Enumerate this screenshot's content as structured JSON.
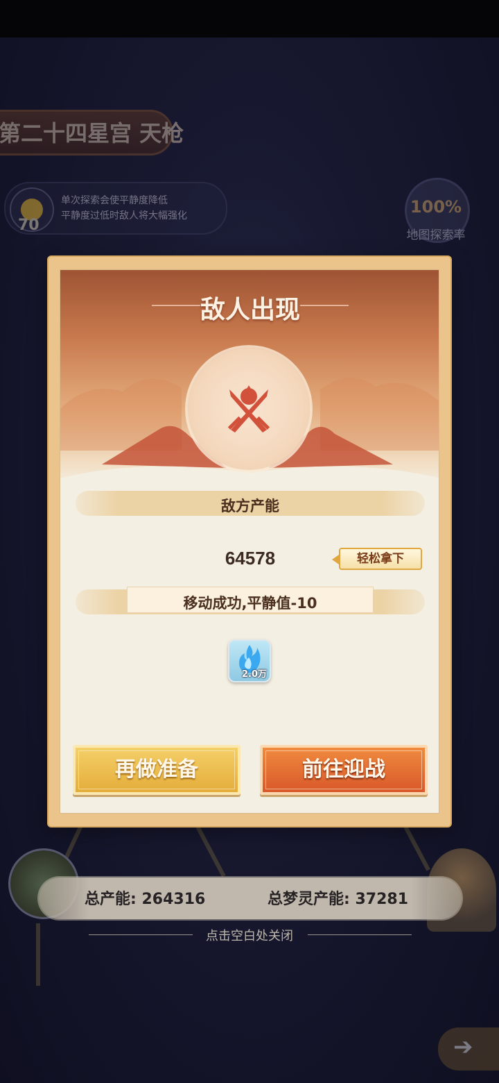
{
  "background": {
    "stage_name": "第二十四星宫 天枪",
    "calm": {
      "value": "70",
      "hint_line1": "单次探索会使平静度降低",
      "hint_line2": "平静度过低时敌人将大幅强化"
    },
    "exploration": {
      "rate": "100%",
      "label": "地图探索率"
    },
    "totals": {
      "total_power": "总产能: 264316",
      "dream_power": "总梦灵产能: 37281"
    },
    "close_hint": "点击空白处关闭"
  },
  "dialog": {
    "title": "敌人出现",
    "enemy_power_label": "敌方产能",
    "enemy_power_value": "64578",
    "difficulty_tag": "轻松拿下",
    "move_result": "移动成功,平静值-10",
    "reward": {
      "icon": "blue-flame-icon",
      "quantity": "2.0万"
    },
    "buttons": {
      "prepare": "再做准备",
      "fight": "前往迎战"
    }
  },
  "colors": {
    "prepare_button": "#e4ad3a",
    "fight_button": "#d9582a",
    "dialog_frame": "#eac48a",
    "dialog_paper": "#f4efe3"
  }
}
